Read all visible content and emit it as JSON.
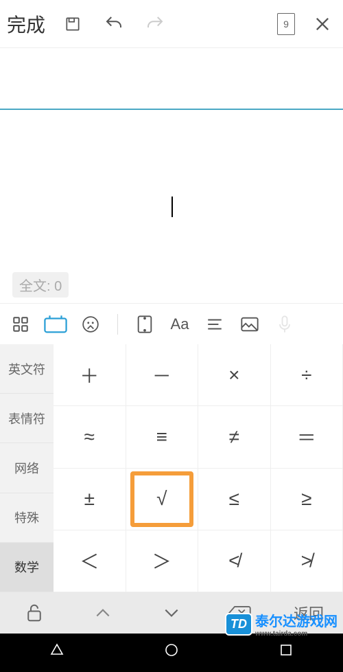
{
  "topBar": {
    "done": "完成",
    "pageNumber": "9"
  },
  "editor": {
    "wordCount": "全文: 0"
  },
  "categories": [
    {
      "label": "英文符",
      "active": false
    },
    {
      "label": "表情符",
      "active": false
    },
    {
      "label": "网络",
      "active": false
    },
    {
      "label": "特殊",
      "active": false
    },
    {
      "label": "数学",
      "active": true
    }
  ],
  "symbols": [
    {
      "glyph": "＋",
      "highlighted": false
    },
    {
      "glyph": "－",
      "highlighted": false
    },
    {
      "glyph": "×",
      "highlighted": false
    },
    {
      "glyph": "÷",
      "highlighted": false
    },
    {
      "glyph": "≈",
      "highlighted": false
    },
    {
      "glyph": "≡",
      "highlighted": false
    },
    {
      "glyph": "≠",
      "highlighted": false
    },
    {
      "glyph": "＝",
      "highlighted": false
    },
    {
      "glyph": "±",
      "highlighted": false
    },
    {
      "glyph": "√",
      "highlighted": true
    },
    {
      "glyph": "≤",
      "highlighted": false
    },
    {
      "glyph": "≥",
      "highlighted": false
    },
    {
      "glyph": "＜",
      "highlighted": false
    },
    {
      "glyph": "＞",
      "highlighted": false
    },
    {
      "glyph": "≮",
      "highlighted": false
    },
    {
      "glyph": "≯",
      "highlighted": false
    }
  ],
  "imeBar": {
    "back": "返回"
  },
  "watermark": {
    "badge": "TD",
    "main": "泰尔达游戏网",
    "sub": "www.tairda.com"
  }
}
